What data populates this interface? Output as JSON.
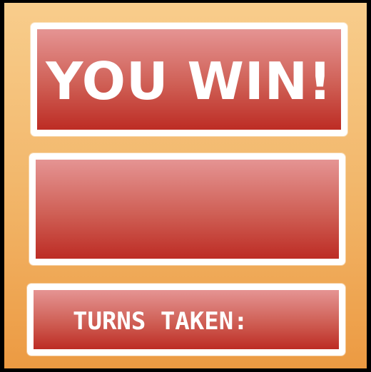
{
  "game": {
    "title": "YOU WIN!",
    "message": "",
    "turns_label": "TURNS TAKEN:",
    "turns_value": ""
  },
  "colors": {
    "background_top": "#f8cd8c",
    "background_bottom": "#ec9a42",
    "panel_top": "#e59493",
    "panel_bottom": "#bd2c24",
    "panel_border": "#ffffff",
    "outer_border": "#000000"
  }
}
